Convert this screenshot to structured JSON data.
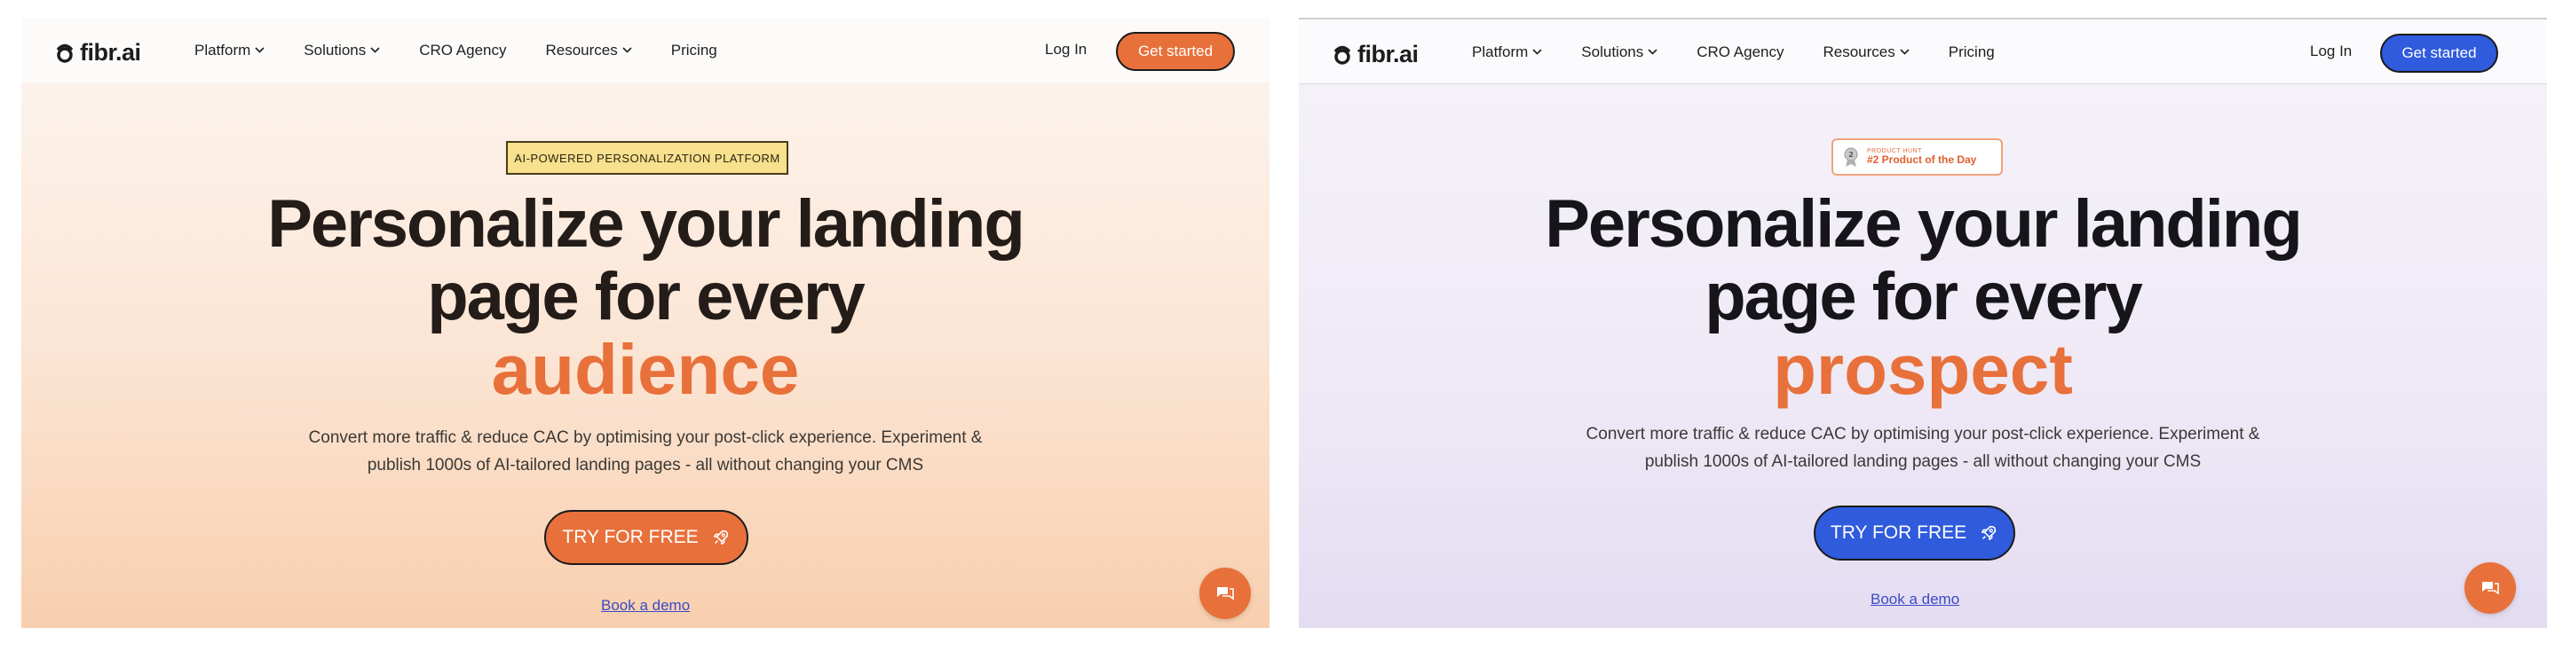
{
  "colors": {
    "orange_accent": "#e8703a",
    "blue_accent": "#2f5bdc",
    "badge_yellow": "#f7e08e"
  },
  "left": {
    "brand": "fibr.ai",
    "nav": {
      "items": [
        {
          "label": "Platform",
          "icon": "chevron-down-icon"
        },
        {
          "label": "Solutions",
          "icon": "chevron-down-icon"
        },
        {
          "label": "CRO Agency",
          "icon": ""
        },
        {
          "label": "Resources",
          "icon": "chevron-down-icon"
        },
        {
          "label": "Pricing",
          "icon": ""
        }
      ],
      "login": "Log In",
      "cta": "Get started"
    },
    "badge": "AI-POWERED PERSONALIZATION PLATFORM",
    "headline": {
      "line1": "Personalize your landing",
      "line2": "page for every",
      "accent": "audience"
    },
    "subtext": {
      "line1": "Convert more traffic & reduce CAC by optimising your post-click experience. Experiment &",
      "line2": "publish 1000s of AI-tailored landing pages - all without changing your CMS"
    },
    "cta_main": "TRY FOR FREE",
    "demo_link": "Book a demo"
  },
  "right": {
    "brand": "fibr.ai",
    "nav": {
      "items": [
        {
          "label": "Platform",
          "icon": "chevron-down-icon"
        },
        {
          "label": "Solutions",
          "icon": "chevron-down-icon"
        },
        {
          "label": "CRO Agency",
          "icon": ""
        },
        {
          "label": "Resources",
          "icon": "chevron-down-icon"
        },
        {
          "label": "Pricing",
          "icon": ""
        }
      ],
      "login": "Log In",
      "cta": "Get started"
    },
    "badge": {
      "small": "PRODUCT HUNT",
      "main": "#2 Product of the Day"
    },
    "headline": {
      "line1": "Personalize your landing",
      "line2": "page for every",
      "accent": "prospect"
    },
    "subtext": {
      "line1": "Convert more traffic & reduce CAC by optimising your post-click experience. Experiment &",
      "line2": "publish 1000s of AI-tailored landing pages - all without changing your CMS"
    },
    "cta_main": "TRY FOR FREE",
    "demo_link": "Book a demo"
  }
}
